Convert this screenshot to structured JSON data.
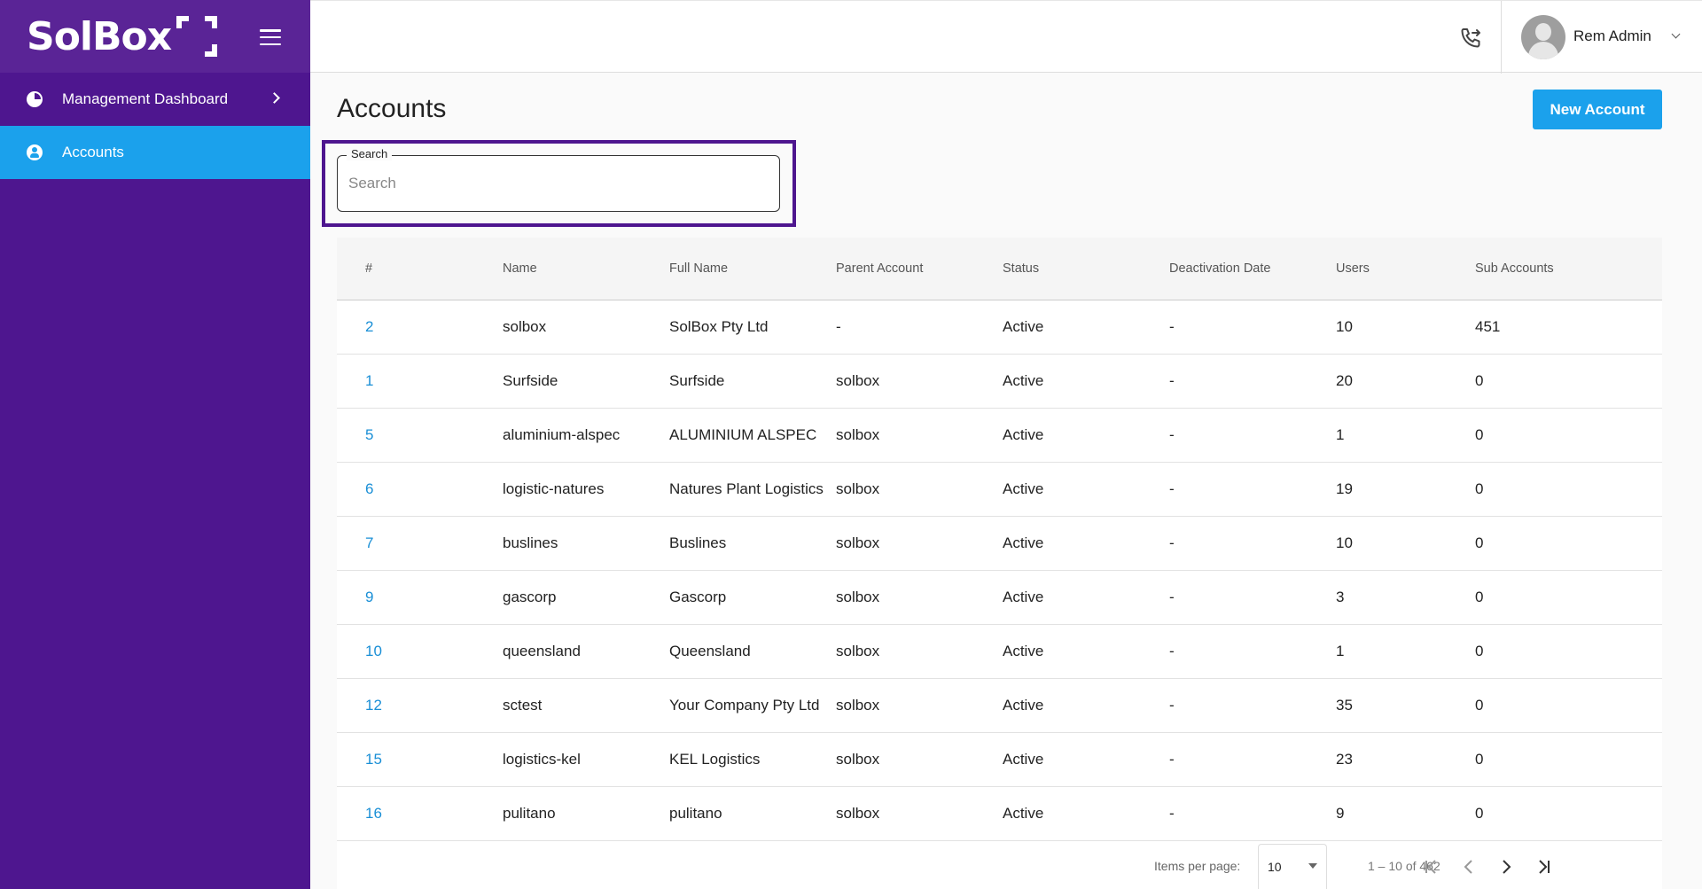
{
  "sidebar": {
    "logo": "SolBox",
    "items": [
      {
        "label": "Management Dashboard",
        "icon": "pie-chart-icon",
        "active": false
      },
      {
        "label": "Accounts",
        "icon": "account-circle-icon",
        "active": true
      }
    ]
  },
  "header": {
    "user_name": "Rem Admin",
    "phone_icon": "phone-forward-icon"
  },
  "main": {
    "title": "Accounts",
    "new_button_label": "New Account",
    "search": {
      "label": "Search",
      "placeholder": "Search",
      "value": ""
    },
    "table": {
      "columns": [
        "#",
        "Name",
        "Full Name",
        "Parent Account",
        "Status",
        "Deactivation Date",
        "Users",
        "Sub Accounts"
      ],
      "rows": [
        {
          "id": "2",
          "name": "solbox",
          "full_name": "SolBox Pty Ltd",
          "parent": "-",
          "status": "Active",
          "deactivation": "-",
          "users": "10",
          "sub_accounts": "451"
        },
        {
          "id": "1",
          "name": "Surfside",
          "full_name": "Surfside",
          "parent": "solbox",
          "status": "Active",
          "deactivation": "-",
          "users": "20",
          "sub_accounts": "0"
        },
        {
          "id": "5",
          "name": "aluminium-alspec",
          "full_name": "ALUMINIUM ALSPEC",
          "parent": "solbox",
          "status": "Active",
          "deactivation": "-",
          "users": "1",
          "sub_accounts": "0"
        },
        {
          "id": "6",
          "name": "logistic-natures",
          "full_name": "Natures Plant Logistics",
          "parent": "solbox",
          "status": "Active",
          "deactivation": "-",
          "users": "19",
          "sub_accounts": "0"
        },
        {
          "id": "7",
          "name": "buslines",
          "full_name": "Buslines",
          "parent": "solbox",
          "status": "Active",
          "deactivation": "-",
          "users": "10",
          "sub_accounts": "0"
        },
        {
          "id": "9",
          "name": "gascorp",
          "full_name": "Gascorp",
          "parent": "solbox",
          "status": "Active",
          "deactivation": "-",
          "users": "3",
          "sub_accounts": "0"
        },
        {
          "id": "10",
          "name": "queensland",
          "full_name": "Queensland",
          "parent": "solbox",
          "status": "Active",
          "deactivation": "-",
          "users": "1",
          "sub_accounts": "0"
        },
        {
          "id": "12",
          "name": "sctest",
          "full_name": "Your Company Pty Ltd",
          "parent": "solbox",
          "status": "Active",
          "deactivation": "-",
          "users": "35",
          "sub_accounts": "0"
        },
        {
          "id": "15",
          "name": "logistics-kel",
          "full_name": "KEL Logistics",
          "parent": "solbox",
          "status": "Active",
          "deactivation": "-",
          "users": "23",
          "sub_accounts": "0"
        },
        {
          "id": "16",
          "name": "pulitano",
          "full_name": "pulitano",
          "parent": "solbox",
          "status": "Active",
          "deactivation": "-",
          "users": "9",
          "sub_accounts": "0"
        }
      ]
    },
    "paginator": {
      "items_per_page_label": "Items per page:",
      "page_size": "10",
      "range": "1 – 10 of 462"
    }
  },
  "colors": {
    "sidebar": "#4e168f",
    "accent": "#1ba1ec",
    "link": "#1a8fd6"
  }
}
